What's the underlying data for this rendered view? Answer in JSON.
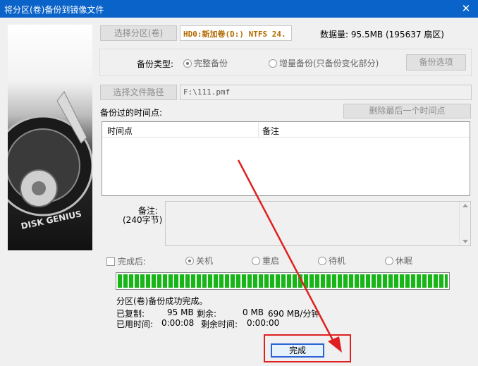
{
  "window": {
    "title": "将分区(卷)备份到镜像文件",
    "close_glyph": "✕"
  },
  "image_logo": {
    "text": "DISK GENIUS"
  },
  "source": {
    "select_partition_button": "选择分区(卷)",
    "partition_info": "HD0:新加卷(D:) NTFS 24.",
    "data_amount": "数据量: 95.5MB (195637 扇区)"
  },
  "backup_type": {
    "label": "备份类型:",
    "full_label": "完整备份",
    "incremental_label": "增量备份(只备份变化部分)",
    "options_button": "备份选项"
  },
  "path": {
    "select_path_button": "选择文件路径",
    "value": "F:\\111.pmf"
  },
  "timepoints": {
    "label": "备份过的时间点:",
    "delete_last_button": "删除最后一个时间点",
    "columns": [
      "时间点",
      "备注"
    ]
  },
  "note": {
    "label": "备注:",
    "limit": "(240字节)"
  },
  "after_complete": {
    "label": "完成后:",
    "options": [
      "关机",
      "重启",
      "待机",
      "休眠"
    ]
  },
  "progress": {
    "fraction": 1.0
  },
  "status": {
    "message": "分区(卷)备份成功完成。",
    "copied_label": "已复制:",
    "copied_value": "95 MB",
    "remaining_label": "剩余:",
    "remaining_value": "0 MB",
    "speed": "690 MB/分钟",
    "elapsed_label": "已用时间:",
    "elapsed_value": "0:00:08",
    "remaining_time_label": "剩余时间:",
    "remaining_time_value": "0:00:00"
  },
  "done_button": "完成",
  "colors": {
    "titlebar": "#0a63c9",
    "progress": "#18b418",
    "highlight": "#e02020"
  }
}
